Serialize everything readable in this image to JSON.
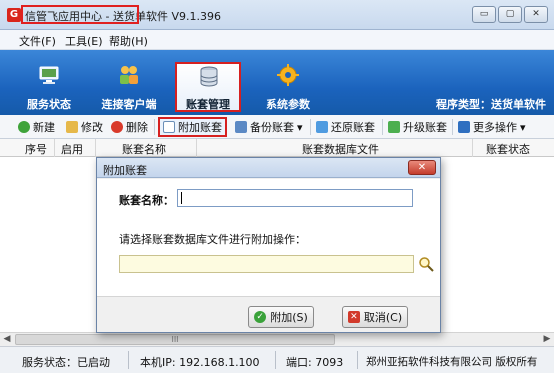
{
  "window": {
    "title": "信管飞应用中心 - 送货单软件 V9.1.396",
    "min_glyph": "▭",
    "max_glyph": "▢",
    "close_glyph": "✕"
  },
  "menu": {
    "file": "文件(F)",
    "tools": "工具(E)",
    "help": "帮助(H)"
  },
  "ribbon": {
    "items": [
      {
        "label": "服务状态",
        "icon": "monitor-icon"
      },
      {
        "label": "连接客户端",
        "icon": "users-icon"
      },
      {
        "label": "账套管理",
        "icon": "database-icon"
      },
      {
        "label": "系统参数",
        "icon": "gear-icon"
      }
    ],
    "program_type": "程序类型：送货单软件"
  },
  "toolbar": {
    "new": "新建",
    "edit": "修改",
    "delete": "删除",
    "attach": "附加账套",
    "backup": "备份账套",
    "restore": "还原账套",
    "upgrade": "升级账套",
    "more": "更多操作"
  },
  "grid": {
    "columns": [
      "序号",
      "启用",
      "账套名称",
      "账套数据库文件",
      "账套状态"
    ]
  },
  "scroll": {
    "left": "◀",
    "right": "▶",
    "grip": "III"
  },
  "dialog": {
    "title": "附加账套",
    "close": "✕",
    "name_label": "账套名称：",
    "name_value": "",
    "choose_label": "请选择账套数据库文件进行附加操作：",
    "file_value": "",
    "ok": "附加(S)",
    "cancel": "取消(C)"
  },
  "status": {
    "service": "服务状态：已启动",
    "ip": "本机IP: 192.168.1.100",
    "port": "端口: 7093",
    "copyright": "郑州亚拓软件科技有限公司 版权所有"
  },
  "colors": {
    "ribbon": "#1b63bd",
    "highlight": "#d62020"
  }
}
